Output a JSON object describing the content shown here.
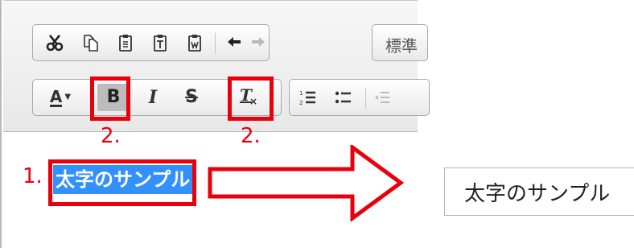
{
  "toolbar": {
    "row1": {
      "icons": [
        "cut-icon",
        "copy-icon",
        "paste-icon",
        "paste-text-icon",
        "paste-word-icon",
        "undo-icon",
        "redo-icon"
      ],
      "format_dropdown_label": "標準"
    },
    "row2": {
      "font_color_label": "A",
      "bold_label": "B",
      "italic_label": "I",
      "strike_label": "S",
      "remove_format_label": "T"
    }
  },
  "annotations": {
    "step1": "1.",
    "step2_bold": "2.",
    "step2_remove": "2."
  },
  "editor": {
    "selected_text": "太字のサンプル"
  },
  "result": {
    "text": "太字のサンプル"
  },
  "colors": {
    "annotation_red": "#e8000b",
    "selection_blue": "#3390ff"
  }
}
